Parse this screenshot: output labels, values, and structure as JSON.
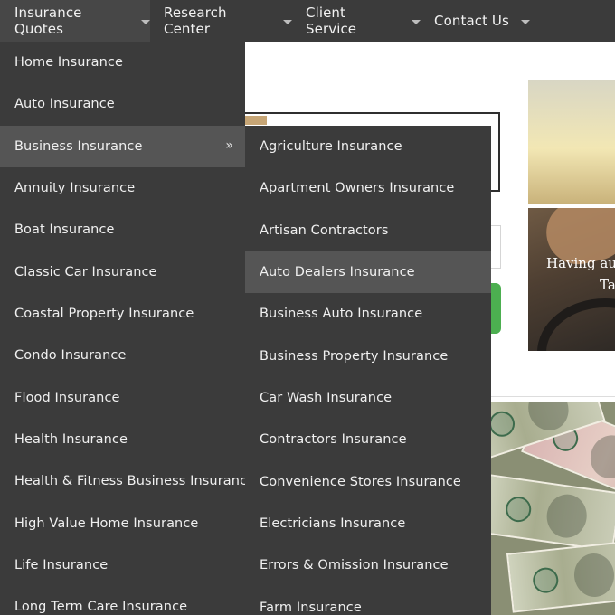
{
  "nav": {
    "items": [
      {
        "label": "Insurance Quotes"
      },
      {
        "label": "Research Center"
      },
      {
        "label": "Client Service"
      },
      {
        "label": "Contact Us"
      }
    ]
  },
  "background": {
    "caption_line1": "Having au",
    "caption_line2": "Ta"
  },
  "menu_insurance": {
    "items": [
      {
        "label": "Home Insurance"
      },
      {
        "label": "Auto Insurance"
      },
      {
        "label": "Business Insurance",
        "submenu_glyph": "»"
      },
      {
        "label": "Annuity Insurance"
      },
      {
        "label": "Boat Insurance"
      },
      {
        "label": "Classic Car Insurance"
      },
      {
        "label": "Coastal Property Insurance"
      },
      {
        "label": "Condo Insurance"
      },
      {
        "label": "Flood Insurance"
      },
      {
        "label": "Health Insurance"
      },
      {
        "label": "Health & Fitness Business Insurance"
      },
      {
        "label": "High Value Home Insurance"
      },
      {
        "label": "Life Insurance"
      },
      {
        "label": "Long Term Care Insurance"
      }
    ]
  },
  "menu_business": {
    "items": [
      {
        "label": "Agriculture Insurance"
      },
      {
        "label": "Apartment Owners Insurance"
      },
      {
        "label": "Artisan Contractors"
      },
      {
        "label": "Auto Dealers Insurance"
      },
      {
        "label": "Business Auto Insurance"
      },
      {
        "label": "Business Property Insurance"
      },
      {
        "label": "Car Wash Insurance"
      },
      {
        "label": "Contractors Insurance"
      },
      {
        "label": "Convenience Stores Insurance"
      },
      {
        "label": "Electricians Insurance"
      },
      {
        "label": "Errors & Omission Insurance"
      },
      {
        "label": "Farm Insurance"
      }
    ]
  },
  "colors": {
    "menu_bg": "#3b3b3b",
    "highlight_bg": "#555555",
    "text": "#f0f0f0",
    "accent_green": "#4caf50"
  }
}
